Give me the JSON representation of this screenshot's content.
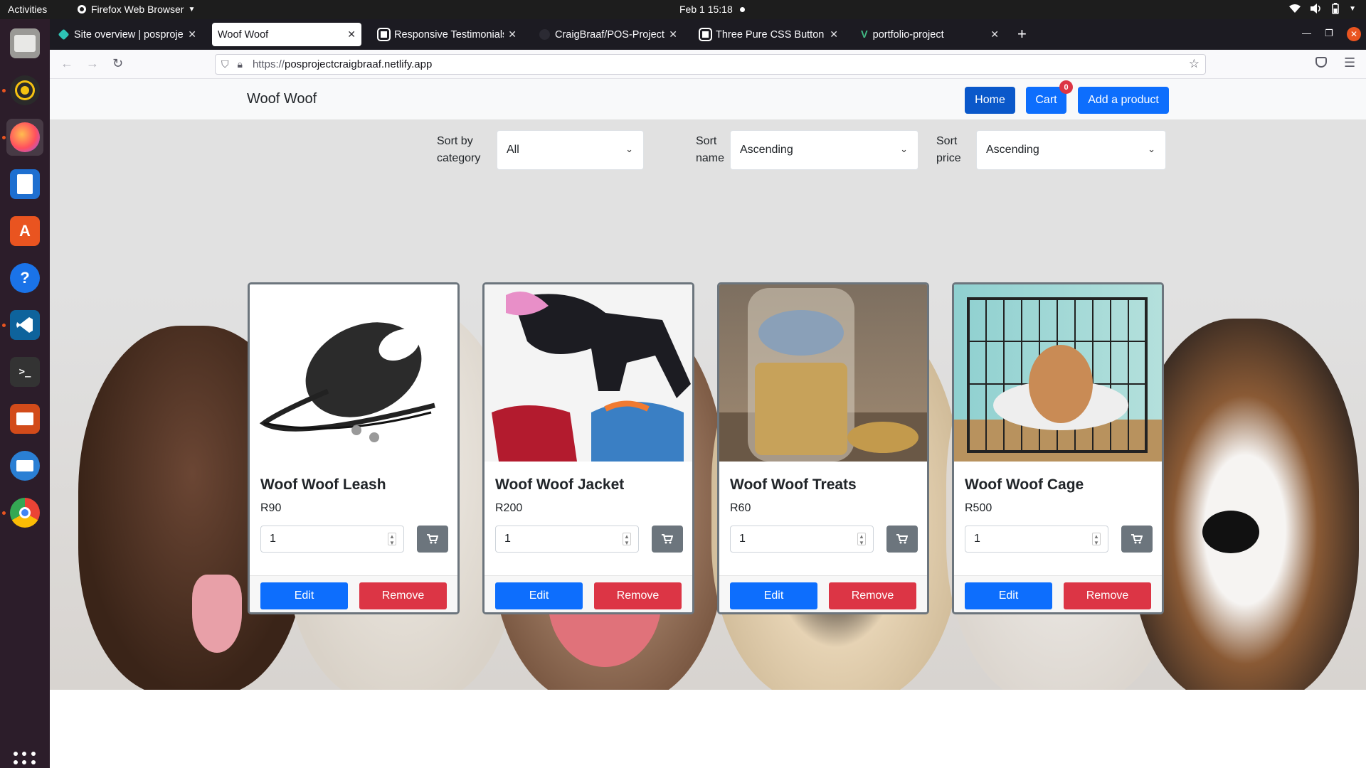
{
  "topbar": {
    "activities": "Activities",
    "app_name": "Firefox Web Browser",
    "datetime": "Feb 1  15:18"
  },
  "dock": {
    "items": [
      "files-icon",
      "rhythmbox-icon",
      "firefox-icon",
      "writer-icon",
      "software-icon",
      "help-icon",
      "vscode-icon",
      "terminal-icon",
      "impress-icon",
      "thunderbird-icon",
      "chrome-icon"
    ]
  },
  "browser": {
    "tabs": [
      {
        "label": "Site overview | posprojec",
        "active": false
      },
      {
        "label": "Woof Woof",
        "active": true
      },
      {
        "label": "Responsive Testimonials",
        "active": false
      },
      {
        "label": "CraigBraaf/POS-Project",
        "active": false
      },
      {
        "label": "Three Pure CSS Button",
        "active": false
      },
      {
        "label": "portfolio-project",
        "active": false
      }
    ],
    "url_scheme": "https://",
    "url_host": "posprojectcraigbraaf.netlify.app"
  },
  "site": {
    "brand": "Woof Woof",
    "nav": {
      "home": "Home",
      "cart": "Cart",
      "cart_count": "0",
      "add_product": "Add a product"
    },
    "filters": {
      "category_label": "Sort by category",
      "category_value": "All",
      "name_label": "Sort name",
      "name_value": "Ascending",
      "price_label": "Sort price",
      "price_value": "Ascending"
    },
    "products": [
      {
        "title": "Woof Woof Leash",
        "price": "R90",
        "qty": "1",
        "edit": "Edit",
        "remove": "Remove"
      },
      {
        "title": "Woof Woof Jacket",
        "price": "R200",
        "qty": "1",
        "edit": "Edit",
        "remove": "Remove"
      },
      {
        "title": "Woof Woof Treats",
        "price": "R60",
        "qty": "1",
        "edit": "Edit",
        "remove": "Remove"
      },
      {
        "title": "Woof Woof Cage",
        "price": "R500",
        "qty": "1",
        "edit": "Edit",
        "remove": "Remove"
      }
    ],
    "colors": {
      "primary": "#0d6efd",
      "danger": "#dc3545",
      "secondary": "#6c757d"
    }
  }
}
